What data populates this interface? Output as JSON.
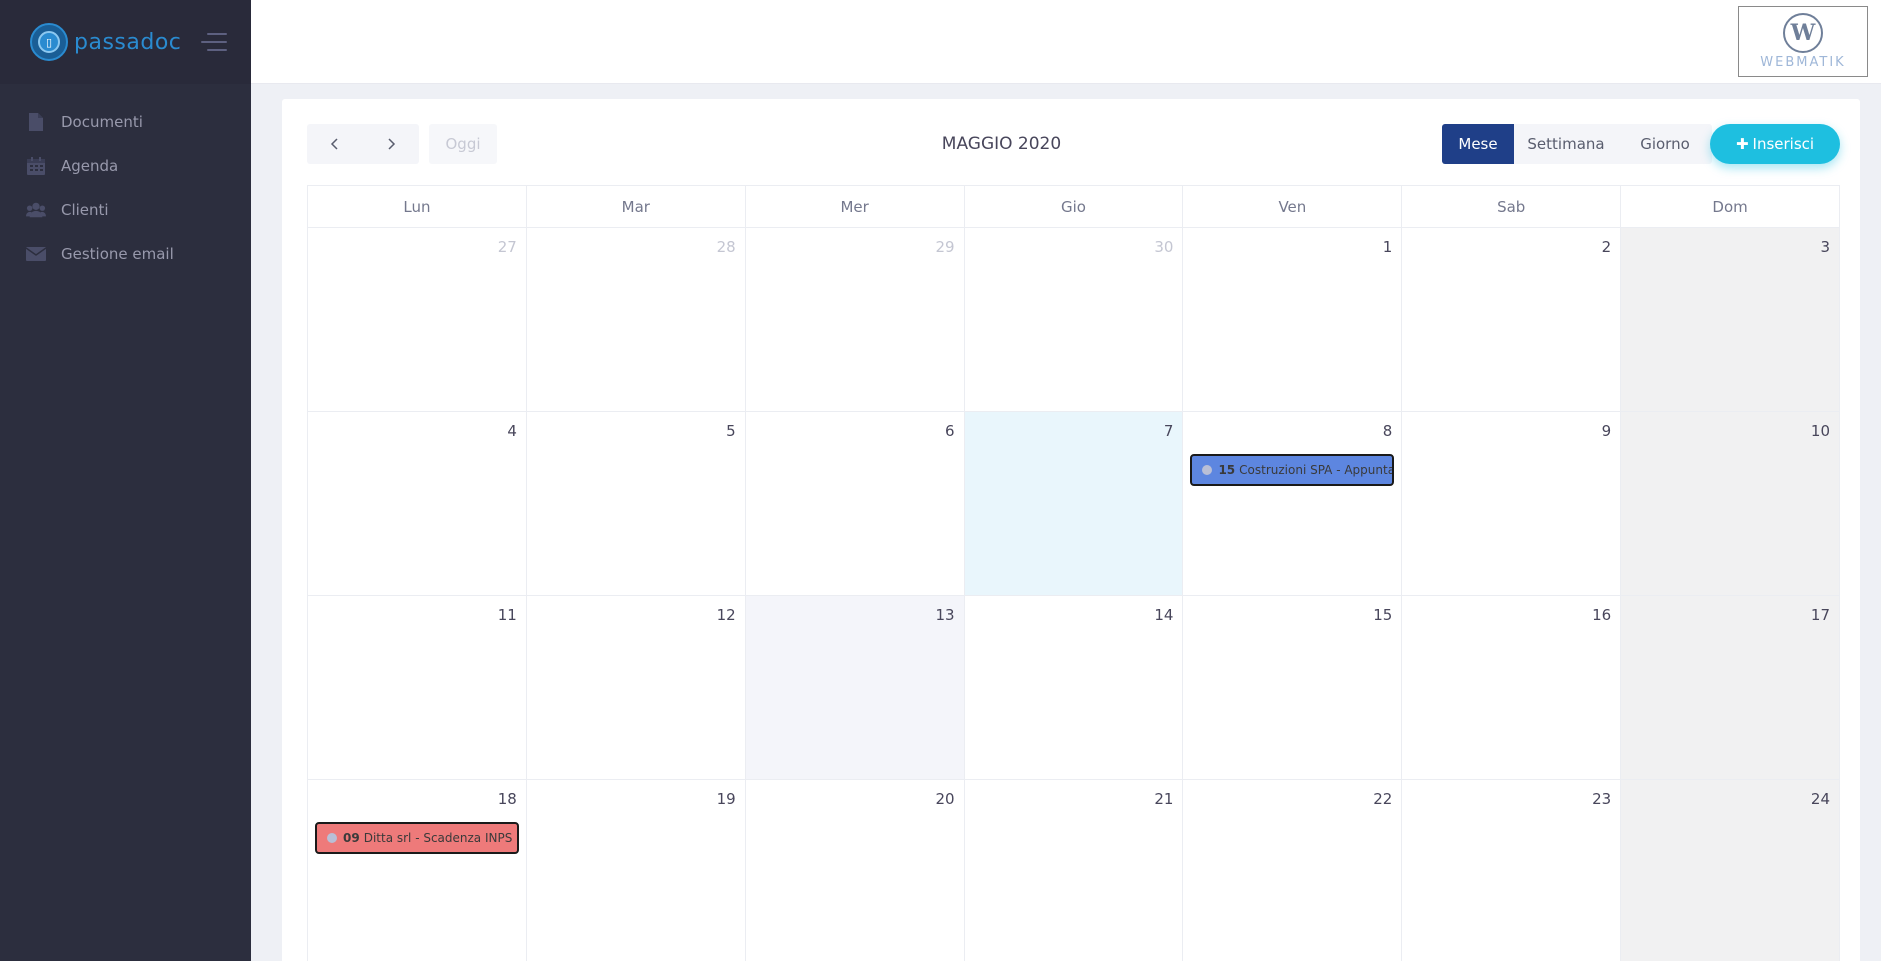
{
  "app": {
    "name": "passadoc",
    "partner_logo_text": "WEBMATIK"
  },
  "sidebar": {
    "items": [
      {
        "label": "Documenti",
        "icon": "file-icon"
      },
      {
        "label": "Agenda",
        "icon": "calendar-icon"
      },
      {
        "label": "Clienti",
        "icon": "users-icon"
      },
      {
        "label": "Gestione email",
        "icon": "envelope-icon"
      }
    ]
  },
  "toolbar": {
    "today_label": "Oggi",
    "title": "MAGGIO 2020",
    "views": {
      "month": "Mese",
      "week": "Settimana",
      "day": "Giorno"
    },
    "add_label": "Inserisci"
  },
  "calendar": {
    "weekdays": [
      "Lun",
      "Mar",
      "Mer",
      "Gio",
      "Ven",
      "Sab",
      "Dom"
    ],
    "weeks": [
      [
        "27",
        "28",
        "29",
        "30",
        "1",
        "2",
        "3"
      ],
      [
        "4",
        "5",
        "6",
        "7",
        "8",
        "9",
        "10"
      ],
      [
        "11",
        "12",
        "13",
        "14",
        "15",
        "16",
        "17"
      ],
      [
        "18",
        "19",
        "20",
        "21",
        "22",
        "23",
        "24"
      ]
    ],
    "events": [
      {
        "time": "15",
        "title": "Costruzioni SPA - Appuntamento",
        "color": "#5d86e0"
      },
      {
        "time": "09",
        "title": "Ditta srl - Scadenza INPS",
        "color": "#ee7a7a"
      }
    ]
  },
  "colors": {
    "sidebar_bg": "#2c2e3e",
    "primary": "#1f3f88",
    "accent": "#1ebfe0",
    "today_bg": "#e9f6fc"
  }
}
